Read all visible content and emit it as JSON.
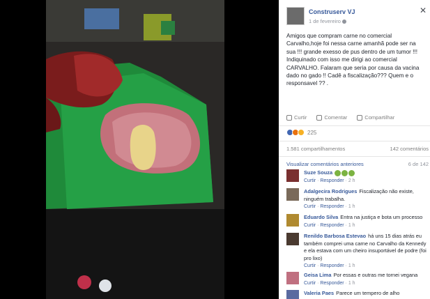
{
  "post": {
    "author": "Construserv VJ",
    "date": "1 de fevereiro",
    "text": "Amigos que compram carne no comercial Carvalho,hoje foi nessa carne amanhã pode ser na sua !!! grande exesso de pus dentro de um tumor !!! Indiquinado com isso me dirigi ao comercial CARVALHO. Falaram que seria por causa da vacina dado no gado !! Cadê a fiscalização??? Quem e o responsavel ?? ."
  },
  "actions": {
    "like": "Curtir",
    "comment": "Comentar",
    "share": "Compartilhar"
  },
  "reactions": {
    "count": "225",
    "colors": {
      "like": "#4267b2",
      "angry": "#e9710f",
      "sad": "#f7b125"
    }
  },
  "stats": {
    "shares": "1.581 compartilhamentos",
    "comments": "142 comentários"
  },
  "previous": {
    "label": "Visualizar comentários anteriores",
    "count": "6 de 142"
  },
  "comments": [
    {
      "name": "Suze Souza",
      "text": "",
      "emoji": "green-faces",
      "meta_like": "Curtir",
      "meta_reply": "Responder",
      "time": "2 h"
    },
    {
      "name": "Adalgecira Rodrigues",
      "text": "Fiscalização não existe, ninguém trabalha.",
      "meta_like": "Curtir",
      "meta_reply": "Responder",
      "time": "1 h"
    },
    {
      "name": "Eduardo Silva",
      "text": "Entra na justiça e bota um processo",
      "meta_like": "Curtir",
      "meta_reply": "Responder",
      "time": "1 h"
    },
    {
      "name": "Renildo Barbosa Estevao",
      "text": "há uns 15 dias atrás eu também comprei uma carne no Carvalho da Kennedy e ela estava com um cheiro insuportável de podre (foi pro lixo)",
      "meta_like": "Curtir",
      "meta_reply": "Responder",
      "time": "1 h"
    },
    {
      "name": "Geisa Lima",
      "text": "Por essas e outras me tornei vegana",
      "meta_like": "Curtir",
      "meta_reply": "Responder",
      "time": "1 h"
    },
    {
      "name": "Valeria Paes",
      "text": "Parece um tempero de alho",
      "meta_like": "",
      "meta_reply": "",
      "time": ""
    }
  ]
}
